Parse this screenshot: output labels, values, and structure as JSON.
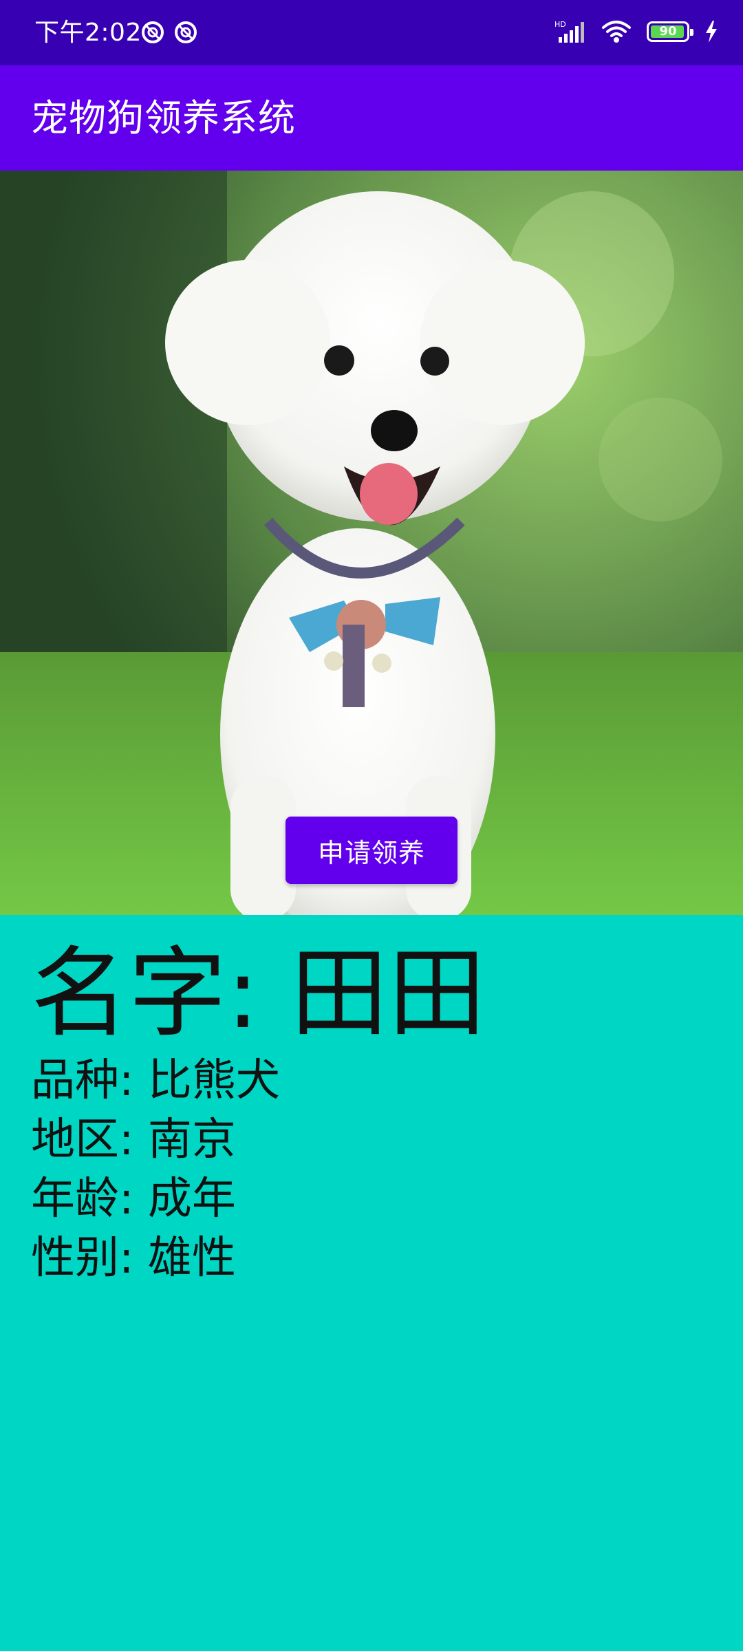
{
  "status_bar": {
    "time": "下午2:02",
    "battery_level": "90",
    "icons": [
      "notification-icon",
      "notification-icon",
      "hd-signal-icon",
      "wifi-icon",
      "battery-icon",
      "charging-icon"
    ]
  },
  "app_bar": {
    "title": "宠物狗领养系统"
  },
  "hero": {
    "image_icon": "dog-photo",
    "apply_button_label": "申请领养"
  },
  "info": {
    "name_label": "名字: 田田",
    "breed_label": "品种: 比熊犬",
    "region_label": "地区: 南京",
    "age_label": "年龄: 成年",
    "gender_label": "性别: 雄性"
  },
  "colors": {
    "status_bar": "#3700B3",
    "app_bar": "#6200EE",
    "accent_button": "#6200EE",
    "info_background": "#00D6C4"
  }
}
